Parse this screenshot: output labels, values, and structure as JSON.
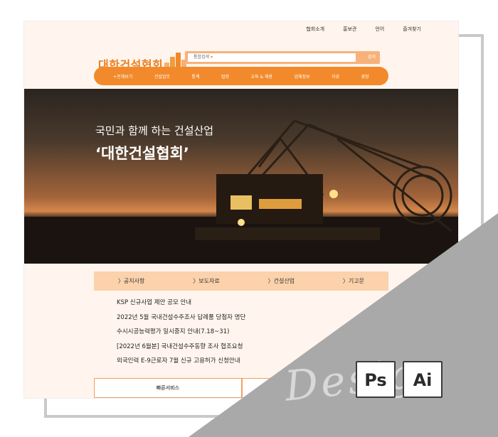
{
  "util_links": [
    "협회소개",
    "홍보관",
    "언어",
    "즐겨찾기"
  ],
  "logo": {
    "text": "대한건설협회"
  },
  "search": {
    "placeholder": "통합검색",
    "button": "검색"
  },
  "nav": [
    "+전체보기",
    "건설업무",
    "통계",
    "법령",
    "교육 & 채용",
    "업체정보",
    "자료",
    "광장"
  ],
  "hero": {
    "line1": "국민과 함께 하는 건설산업",
    "line2": "‘대한건설협회’"
  },
  "tabs": [
    "〉공지사항",
    "〉보도자료",
    "〉건설산업",
    "〉기고문"
  ],
  "news": [
    "KSP 신규사업 제안 공모 안내",
    "2022년 5월 국내건설수주조사 답례품 당첨자 명단",
    "수시시공능력평가 일시중지 안내(7.18~31)",
    "[2022년 6월분] 국내건설수주동향 조사 협조요청",
    "외국인력 E-9근로자 7월 신규 고용허가 신청안내"
  ],
  "quick": {
    "label": "빠른서비스"
  },
  "badges": {
    "ps": "Ps",
    "ai": "Ai"
  },
  "watermark": "Design",
  "colors": {
    "accent": "#f28a2b",
    "tab_bg": "#fbd2ac",
    "page_bg": "#fff5ee"
  }
}
